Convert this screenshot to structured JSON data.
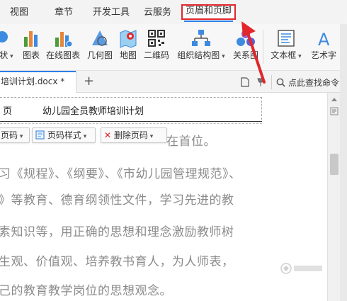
{
  "tabs": [
    {
      "label": "视图"
    },
    {
      "label": "章节"
    },
    {
      "label": "开发工具"
    },
    {
      "label": "云服务"
    },
    {
      "label": "页眉和页脚"
    }
  ],
  "ribbon": {
    "shape_partial": "状",
    "chart": "图表",
    "online_chart": "在线图表",
    "geometry": "几何图",
    "map": "地图",
    "qrcode": "二维码",
    "org_chart": "组织结构图",
    "relation": "关系图",
    "textbox": "文本框",
    "wordart": "艺术字"
  },
  "doc": {
    "tab_title": "培训计划.docx *",
    "add_tab": "+",
    "search_label": "点此查找命令"
  },
  "header": {
    "page_partial": "页",
    "title": "幼儿园全员教师培训计划"
  },
  "hf_toolbar": {
    "page_number": "页码",
    "page_style": "页码样式",
    "delete_page_number": "删除页码"
  },
  "body_lines": [
    "在首位。",
    "习《规程》、《纲要》、《市幼儿园管理规范》、",
    "》等教育、德育纲领性文件，学习先进的教",
    "素知识等，用正确的思想和理念激励教师树",
    "生观、价值观、培养教书育人，为人师表，",
    "己的教育教学岗位的思想观念。"
  ],
  "colors": {
    "highlight_box": "#e3262b",
    "arrow": "#e3262b",
    "accent": "#2d7de6"
  }
}
